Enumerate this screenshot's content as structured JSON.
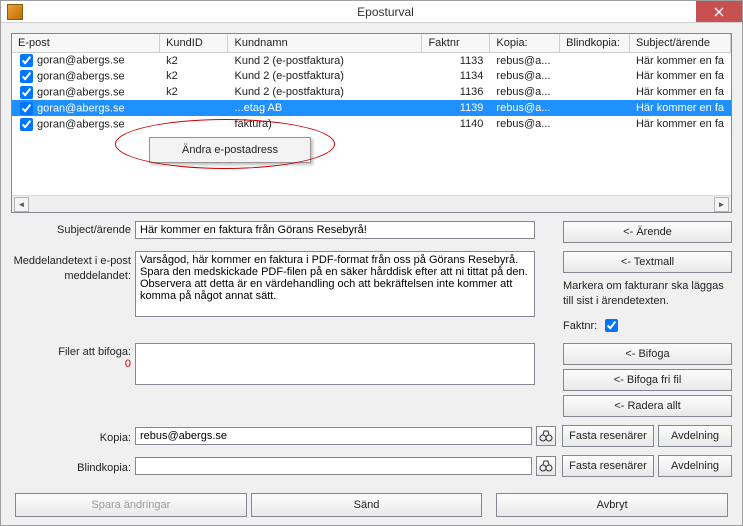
{
  "title": "Eposturval",
  "table": {
    "headers": [
      "E-post",
      "KundID",
      "Kundnamn",
      "Faktnr",
      "Kopia:",
      "Blindkopia:",
      "Subject/ärende"
    ],
    "rows": [
      {
        "email": "goran@abergs.se",
        "kundid": "k2",
        "kundnamn": "Kund 2 (e-postfaktura)",
        "faktnr": "1133",
        "kopia": "rebus@a...",
        "blind": "",
        "subject": "Här kommer en fa",
        "selected": false
      },
      {
        "email": "goran@abergs.se",
        "kundid": "k2",
        "kundnamn": "Kund 2 (e-postfaktura)",
        "faktnr": "1134",
        "kopia": "rebus@a...",
        "blind": "",
        "subject": "Här kommer en fa",
        "selected": false
      },
      {
        "email": "goran@abergs.se",
        "kundid": "k2",
        "kundnamn": "Kund 2 (e-postfaktura)",
        "faktnr": "1136",
        "kopia": "rebus@a...",
        "blind": "",
        "subject": "Här kommer en fa",
        "selected": false
      },
      {
        "email": "goran@abergs.se",
        "kundid": "",
        "kundnamn": "...etag AB",
        "faktnr": "1139",
        "kopia": "rebus@a...",
        "blind": "",
        "subject": "Här kommer en fa",
        "selected": true
      },
      {
        "email": "goran@abergs.se",
        "kundid": "",
        "kundnamn": "faktura)",
        "faktnr": "1140",
        "kopia": "rebus@a...",
        "blind": "",
        "subject": "Här kommer en fa",
        "selected": false
      }
    ]
  },
  "context_menu": {
    "label": "Ändra e-postadress"
  },
  "labels": {
    "subject": "Subject/ärende",
    "body": "Meddelandetext i e-post meddelandet:",
    "filer": "Filer att bifoga:",
    "kopia": "Kopia:",
    "blindkopia": "Blindkopia:",
    "faktnr": "Faktnr:"
  },
  "fields": {
    "subject": "Här kommer en faktura från Görans Resebyrå!",
    "body": "Varsågod, här kommer en faktura i PDF-format från oss på Görans Resebyrå.\nSpara den medskickade PDF-filen på en säker hårddisk efter att ni tittat på den.\nObservera att detta är en värdehandling och att bekräftelsen inte kommer att komma på något annat sätt.",
    "filer_count": "0",
    "kopia": "rebus@abergs.se",
    "blindkopia": ""
  },
  "buttons": {
    "arende": "<- Ärende",
    "textmall": "<- Textmall",
    "bifoga": "<- Bifoga",
    "bifoga_fri": "<- Bifoga fri fil",
    "radera_allt": "<- Radera allt",
    "fasta": "Fasta resenärer",
    "avdelning": "Avdelning",
    "spara": "Spara ändringar",
    "sand": "Sänd",
    "avbryt": "Avbryt"
  },
  "hint": "Markera om fakturanr ska läggas till sist i ärendetexten."
}
